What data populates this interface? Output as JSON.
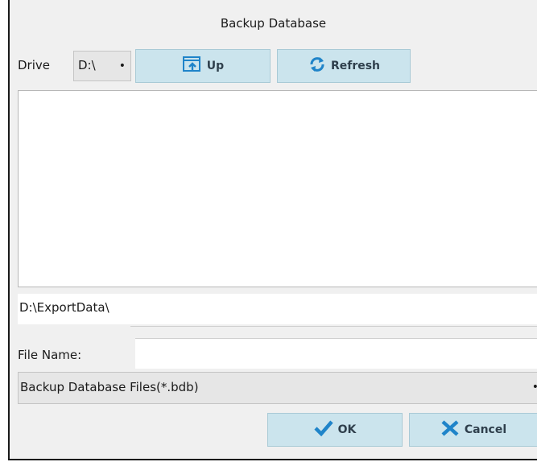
{
  "dialog": {
    "title": "Backup Database"
  },
  "toolbar": {
    "drive_label": "Drive",
    "drive_value": "D:\\",
    "up_label": "Up",
    "refresh_label": "Refresh"
  },
  "file_list": {
    "items": []
  },
  "path": {
    "value": "D:\\ExportData\\"
  },
  "filename": {
    "label": "File Name:",
    "value": ""
  },
  "filter": {
    "value": "Backup Database Files(*.bdb)"
  },
  "actions": {
    "ok_label": "OK",
    "cancel_label": "Cancel"
  },
  "icons": {
    "up": "folder-up-icon",
    "refresh": "refresh-icon",
    "ok": "checkmark-icon",
    "cancel": "x-icon",
    "dropdown": "caret-down-icon"
  },
  "colors": {
    "button_bg": "#cbe4ed",
    "icon_blue": "#1f84c9",
    "dialog_bg": "#f0f0f0"
  }
}
